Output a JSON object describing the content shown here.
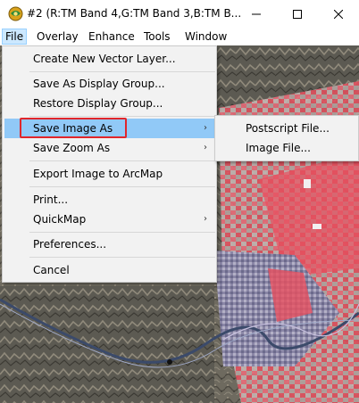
{
  "window": {
    "title": "#2 (R:TM Band 4,G:TM Band 3,B:TM B...",
    "controls": [
      "minimize",
      "maximize",
      "close"
    ]
  },
  "menubar": {
    "items": [
      {
        "label": "File",
        "active": true
      },
      {
        "label": "Overlay"
      },
      {
        "label": "Enhance"
      },
      {
        "label": "Tools"
      },
      {
        "label": "Window"
      }
    ]
  },
  "file_menu": {
    "items": [
      {
        "label": "Create New Vector Layer..."
      },
      {
        "label": "Save As Display Group..."
      },
      {
        "label": "Restore Display Group..."
      },
      {
        "label": "Save Image As",
        "submenu": true,
        "highlighted": true
      },
      {
        "label": "Save Zoom As",
        "submenu": true
      },
      {
        "label": "Export Image to ArcMap"
      },
      {
        "label": "Print..."
      },
      {
        "label": "QuickMap",
        "submenu": true
      },
      {
        "label": "Preferences..."
      },
      {
        "label": "Cancel"
      }
    ],
    "arrow_glyph": "›"
  },
  "save_image_submenu": {
    "items": [
      {
        "label": "Postscript File..."
      },
      {
        "label": "Image File..."
      }
    ]
  },
  "colors": {
    "highlight_bg": "#91c9f7",
    "annotation_border": "#e0262b",
    "menu_bg": "#f2f2f2",
    "urban_red": "#e8505f"
  }
}
